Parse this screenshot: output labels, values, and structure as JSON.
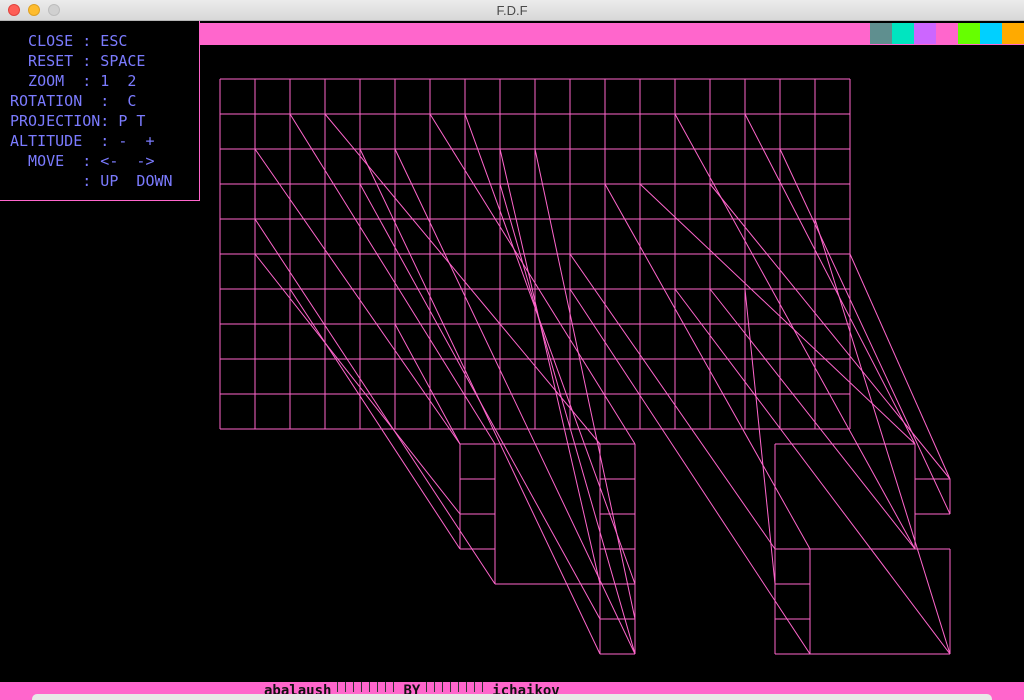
{
  "window": {
    "title": "F.D.F"
  },
  "controls": [
    "  CLOSE : ESC",
    "  RESET : SPACE",
    "  ZOOM  : 1  2",
    "ROTATION  :  C",
    "PROJECTION: P T",
    "ALTITUDE  : -  +",
    "  MOVE  : <-  ->",
    "        : UP  DOWN"
  ],
  "palette": [
    "#5f8f8f",
    "#00e5c0",
    "#cc66ff",
    "#ff66cc",
    "#66ff00",
    "#00d0ff",
    "#ffaa00"
  ],
  "wireframe_color": "#ff66cc",
  "footer": {
    "author1": "abalaush",
    "by": "BY",
    "author2": "ichaikov"
  }
}
